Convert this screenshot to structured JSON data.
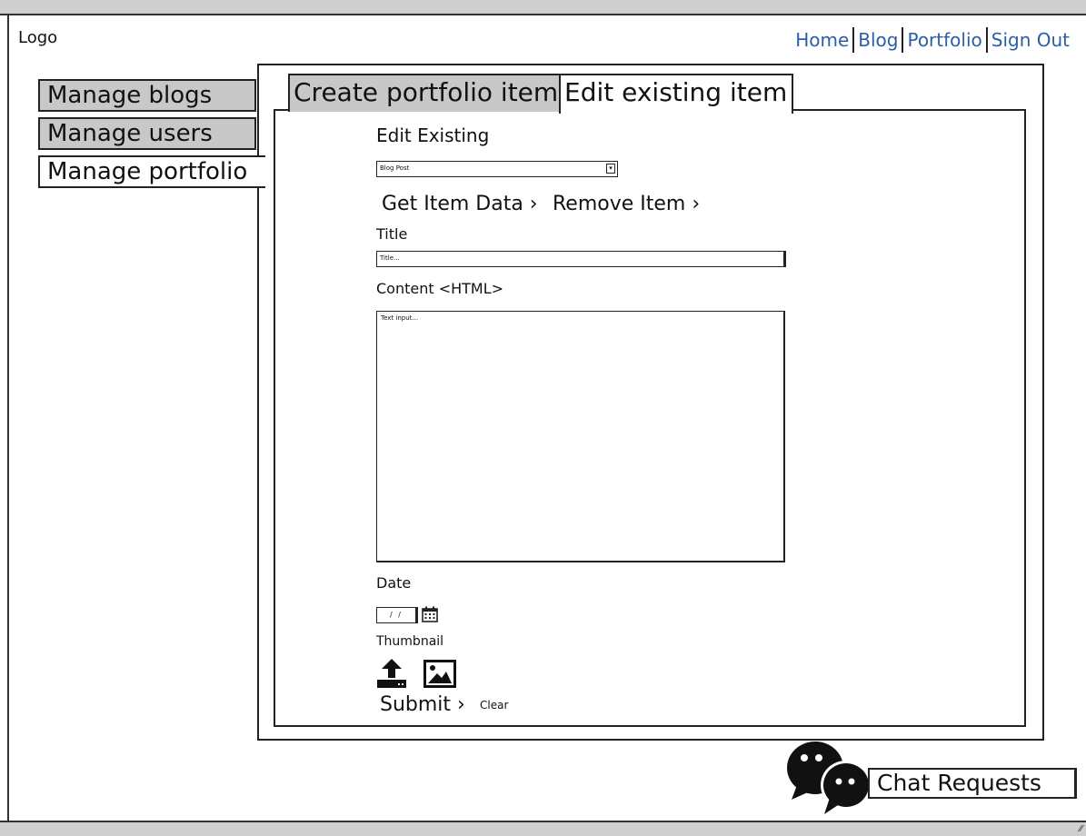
{
  "header": {
    "logo": "Logo",
    "nav": [
      "Home",
      "Blog",
      "Portfolio",
      "Sign Out"
    ]
  },
  "sidebar": {
    "items": [
      {
        "label": "Manage blogs",
        "active": false
      },
      {
        "label": "Manage users",
        "active": false
      },
      {
        "label": "Manage portfolio",
        "active": true
      }
    ]
  },
  "tabs": [
    {
      "label": "Create portfolio item",
      "active": false
    },
    {
      "label": "Edit existing item",
      "active": true
    }
  ],
  "form": {
    "heading": "Edit Existing",
    "select_value": "Blog Post",
    "select_arrow": "▾",
    "get_item_link": "Get Item Data ›",
    "remove_item_link": "Remove Item ›",
    "title_label": "Title",
    "title_placeholder": "Title...",
    "content_label": "Content <HTML>",
    "content_placeholder": "Text input...",
    "date_label": "Date",
    "date_value": "/ /",
    "thumbnail_label": "Thumbnail",
    "submit_link": "Submit ›",
    "clear_link": "Clear"
  },
  "chat": {
    "button_label": "Chat Requests"
  },
  "icons": {
    "calendar": "calendar-icon",
    "upload": "upload-icon",
    "image": "image-icon",
    "chat": "chat-bubbles-icon"
  },
  "colors": {
    "nav_link": "#2a5fa8",
    "inactive_fill": "#c8c8c8",
    "chrome_bar": "#cfcfcf"
  }
}
